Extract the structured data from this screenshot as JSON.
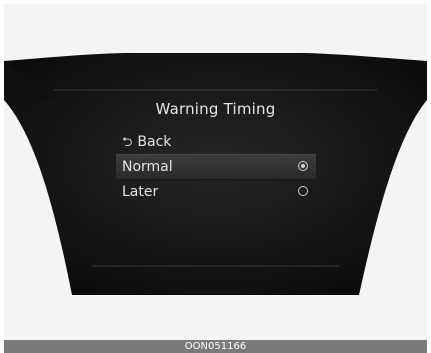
{
  "screen": {
    "title": "Warning Timing"
  },
  "menu": {
    "back_label": "Back",
    "back_icon": "return-arrow-icon",
    "options": [
      {
        "label": "Normal",
        "selected": true
      },
      {
        "label": "Later",
        "selected": false
      }
    ]
  },
  "footer": {
    "code": "OON051166"
  },
  "colors": {
    "display_bg": "#141414",
    "highlight": "#333333",
    "text": "#e4e4e4"
  }
}
